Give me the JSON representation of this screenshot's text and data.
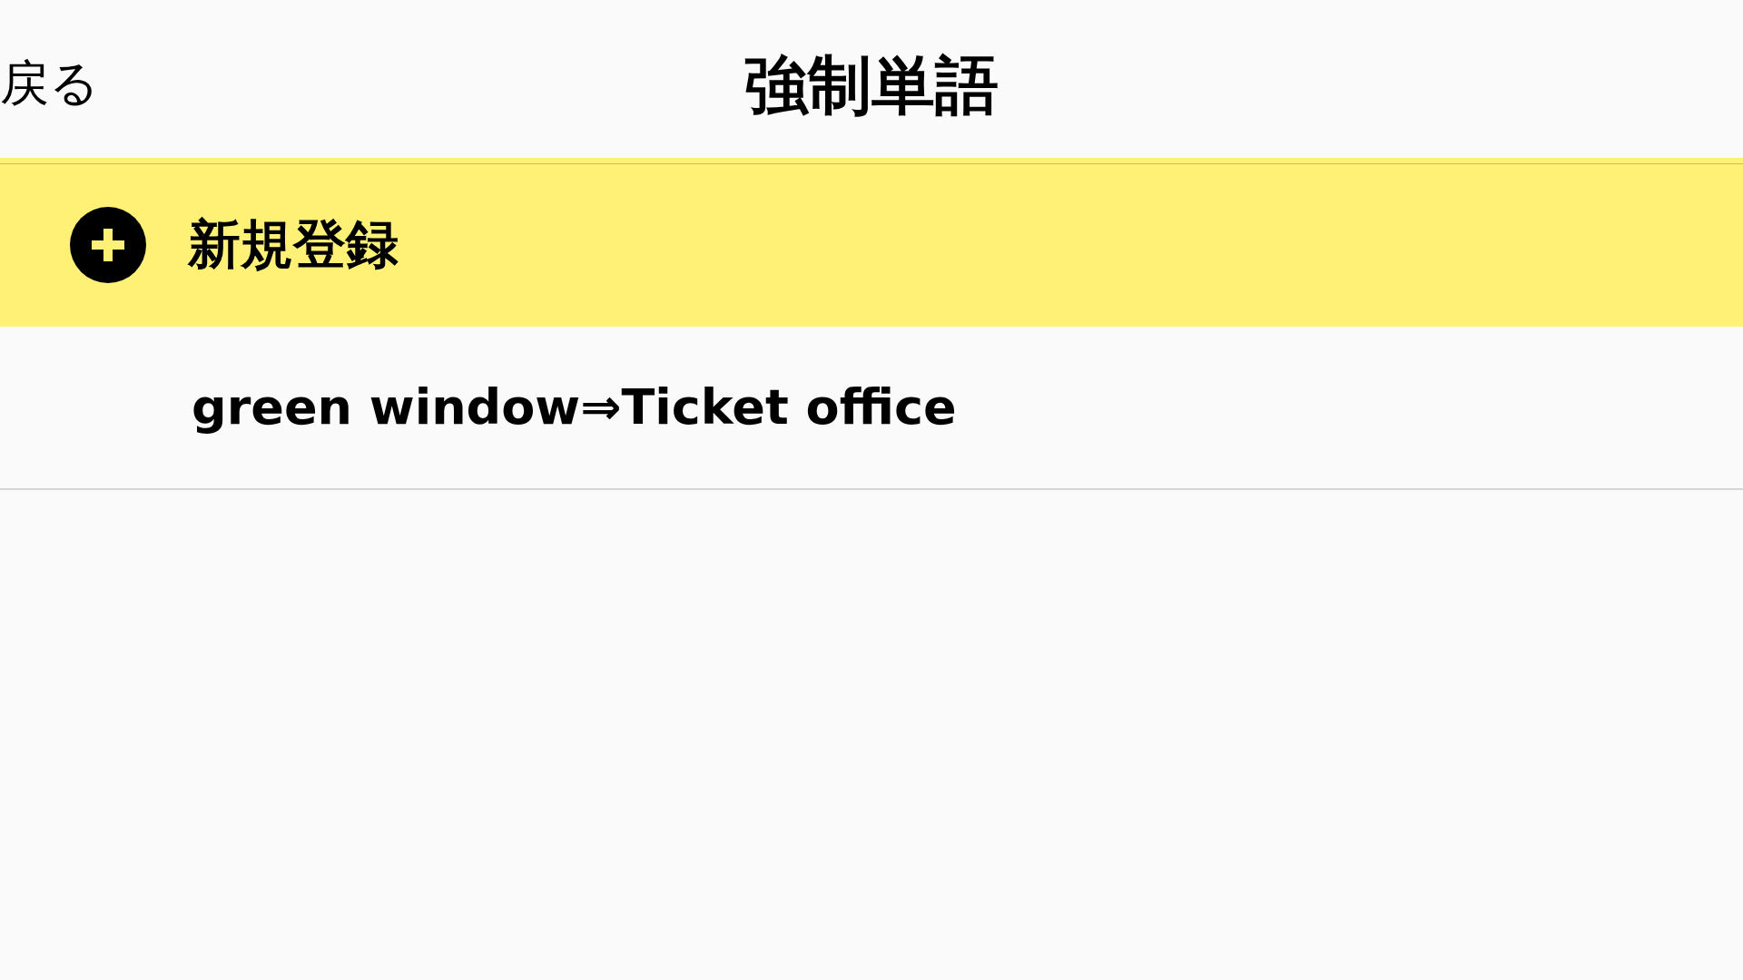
{
  "header": {
    "back": "戻る",
    "title": "強制単語"
  },
  "add_row": {
    "label": "新規登録"
  },
  "items": [
    {
      "text": "green window⇒Ticket office"
    }
  ]
}
